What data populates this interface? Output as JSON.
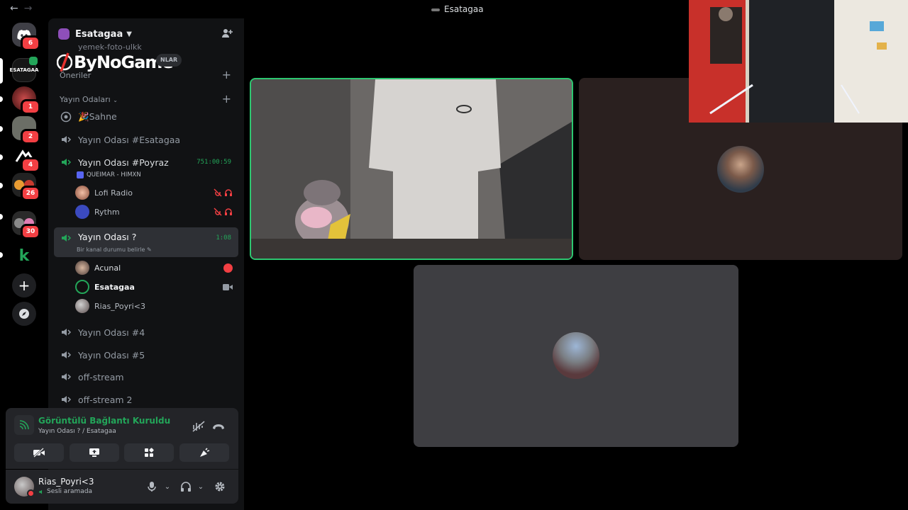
{
  "window": {
    "title": "Esatagaa"
  },
  "rail": {
    "servers": [
      {
        "name": "Discord",
        "badge": "6"
      },
      {
        "name": "ESATAGAA",
        "badge": ""
      },
      {
        "name": "server-3",
        "badge": "1"
      },
      {
        "name": "server-4",
        "badge": "2"
      },
      {
        "name": "server-5",
        "badge": "4"
      },
      {
        "name": "folder-1",
        "badge": "26"
      },
      {
        "name": "folder-2",
        "badge": "30"
      },
      {
        "name": "server-8",
        "badge": ""
      }
    ]
  },
  "sidebar": {
    "server_name": "Esatagaa",
    "prev_channel": "yemek-foto-ulkk",
    "overlay_logo": "ByNoGame",
    "overlay_chip": "NLAR",
    "categories": {
      "suggestions": "Öneriler",
      "streams": "Yayın Odaları"
    },
    "channels": {
      "stage": "Sahne",
      "esatagaa": "Yayın Odası #Esatagaa",
      "poyraz": "Yayın Odası #Poyraz",
      "poyraz_timer": "751:00:59",
      "poyraz_activity": "QUEIMAR - HIMXN",
      "active": "Yayın Odası ?",
      "active_timer": "1:08",
      "active_status": "Bir kanal durumu belirle",
      "ch4": "Yayın Odası #4",
      "ch5": "Yayın Odası #5",
      "off1": "off-stream",
      "off2": "off-stream 2"
    },
    "poyraz_members": [
      "Lofi Radio",
      "Rythm"
    ],
    "active_members": [
      "Acunal",
      "Esatagaa",
      "Rias_Poyri<3"
    ]
  },
  "voice_panel": {
    "title": "Görüntülü Bağlantı Kuruldu",
    "subtitle": "Yayın Odası ? / Esatagaa"
  },
  "user_panel": {
    "name": "Rias_Poyri<3",
    "status": "Sesli aramada"
  },
  "colors": {
    "accent_green": "#23a559",
    "speaking_border": "#2dc770",
    "danger": "#f23f43",
    "blurple": "#5865f2"
  }
}
